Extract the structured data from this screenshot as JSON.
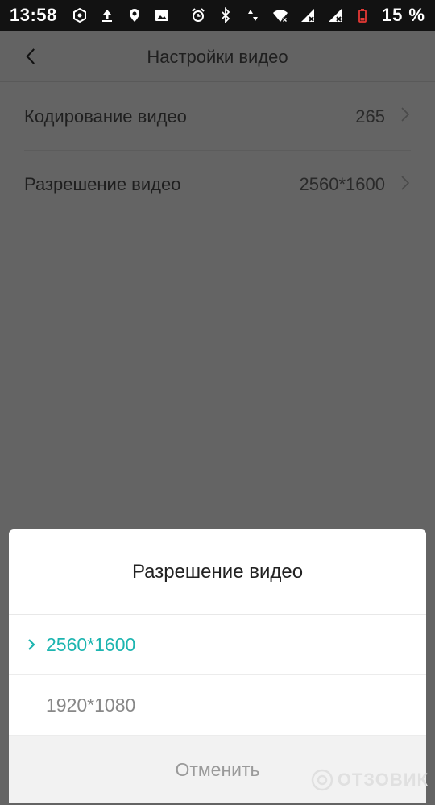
{
  "status_bar": {
    "time": "13:58",
    "battery_percent": "15 %",
    "icons_left": [
      "gear-hex-icon",
      "upload-icon",
      "location-icon",
      "image-icon"
    ],
    "icons_right": [
      "alarm-icon",
      "bluetooth-icon",
      "data-arrows-icon",
      "wifi-off-icon",
      "signal-off-icon",
      "signal-off-icon-2",
      "battery-low-icon"
    ]
  },
  "header": {
    "title": "Настройки видео"
  },
  "settings": [
    {
      "label": "Кодирование видео",
      "value": "265"
    },
    {
      "label": "Разрешение видео",
      "value": "2560*1600"
    }
  ],
  "sheet": {
    "title": "Разрешение видео",
    "options": [
      {
        "label": "2560*1600",
        "selected": true
      },
      {
        "label": "1920*1080",
        "selected": false
      }
    ],
    "cancel_label": "Отменить",
    "accent_color": "#1db5b0"
  },
  "watermark": {
    "text": "ОТЗОВИК"
  }
}
